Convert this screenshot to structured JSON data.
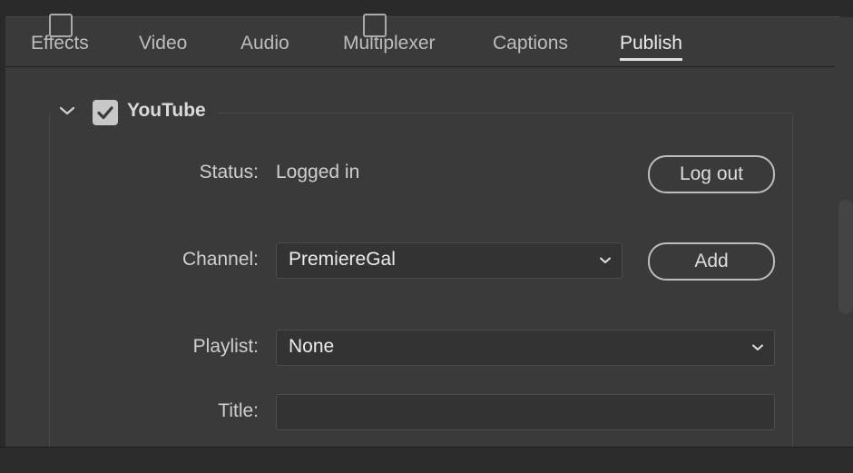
{
  "tabs": [
    {
      "label": "Effects",
      "active": false
    },
    {
      "label": "Video",
      "active": false
    },
    {
      "label": "Audio",
      "active": false
    },
    {
      "label": "Multiplexer",
      "active": false
    },
    {
      "label": "Captions",
      "active": false
    },
    {
      "label": "Publish",
      "active": true
    }
  ],
  "youtube": {
    "title": "YouTube",
    "enabled": true,
    "expanded": true,
    "status_label": "Status:",
    "status_value": "Logged in",
    "logout_label": "Log out",
    "channel_label": "Channel:",
    "channel_value": "PremiereGal",
    "add_label": "Add",
    "playlist_label": "Playlist:",
    "playlist_value": "None",
    "title_label": "Title:",
    "title_value": ""
  },
  "colors": {
    "panel_bg": "#3a3a3a",
    "text": "#cfcfcf",
    "active_tab_underline": "#e0e0e0"
  }
}
